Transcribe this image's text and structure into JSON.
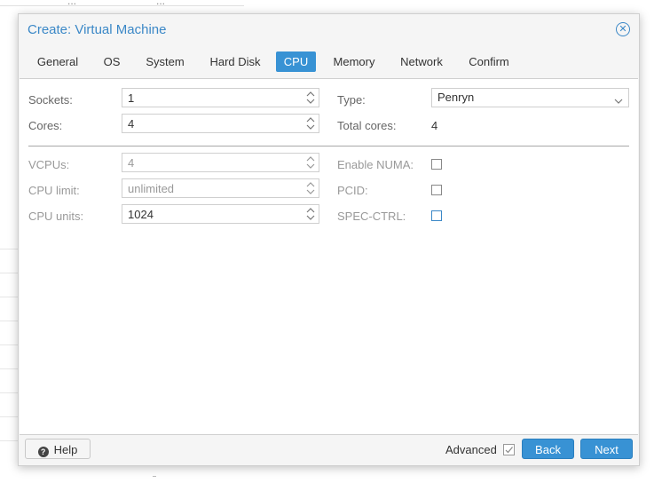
{
  "background": {
    "top_text_left": "...",
    "top_text_mid": "..."
  },
  "dialog": {
    "title": "Create: Virtual Machine",
    "close_icon": "close-circle-icon"
  },
  "tabs": [
    {
      "label": "General",
      "active": false
    },
    {
      "label": "OS",
      "active": false
    },
    {
      "label": "System",
      "active": false
    },
    {
      "label": "Hard Disk",
      "active": false
    },
    {
      "label": "CPU",
      "active": true
    },
    {
      "label": "Memory",
      "active": false
    },
    {
      "label": "Network",
      "active": false
    },
    {
      "label": "Confirm",
      "active": false
    }
  ],
  "cpu": {
    "sockets": {
      "label": "Sockets:",
      "value": "1"
    },
    "cores": {
      "label": "Cores:",
      "value": "4"
    },
    "type": {
      "label": "Type:",
      "value": "Penryn"
    },
    "total_cores": {
      "label": "Total cores:",
      "value": "4"
    },
    "vcpus": {
      "label": "VCPUs:",
      "value": "4"
    },
    "cpu_limit": {
      "label": "CPU limit:",
      "value": "unlimited"
    },
    "cpu_units": {
      "label": "CPU units:",
      "value": "1024"
    },
    "enable_numa": {
      "label": "Enable NUMA:",
      "checked": false
    },
    "pcid": {
      "label": "PCID:",
      "checked": false
    },
    "spec_ctrl": {
      "label": "SPEC-CTRL:",
      "checked": false
    }
  },
  "footer": {
    "help_label": "Help",
    "advanced_label": "Advanced",
    "advanced_checked": true,
    "back_label": "Back",
    "next_label": "Next"
  },
  "colors": {
    "accent": "#3892d4",
    "title": "#3b88c7"
  }
}
